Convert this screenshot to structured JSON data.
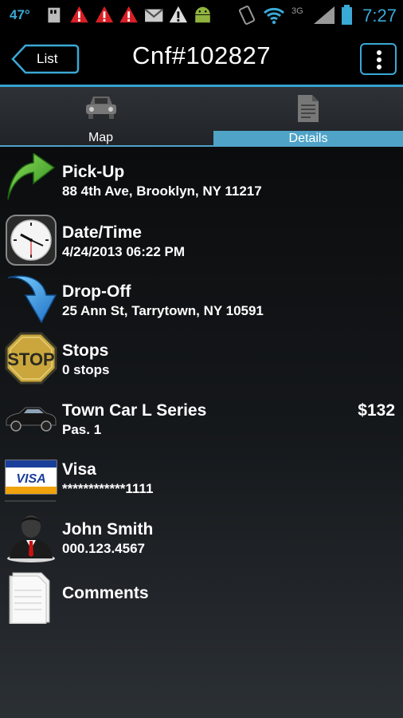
{
  "status_bar": {
    "temperature": "47°",
    "time": "7:27",
    "network": "3G",
    "icons": [
      "weather-icon",
      "sd-card-icon",
      "warning-icon",
      "warning-icon",
      "warning-icon",
      "gmail-icon",
      "alert-icon",
      "android-icon",
      "vibrate-icon",
      "wifi-icon",
      "signal-icon",
      "battery-icon"
    ]
  },
  "header": {
    "back_label": "List",
    "title": "Cnf#102827",
    "accent_color": "#35a3cf"
  },
  "tabs": [
    {
      "label": "Map",
      "icon": "car-icon",
      "selected": false
    },
    {
      "label": "Details",
      "icon": "document-icon",
      "selected": true
    }
  ],
  "details": {
    "pickup": {
      "title": "Pick-Up",
      "value": "88 4th Ave, Brooklyn, NY 11217",
      "icon": "green-arrow-up-icon"
    },
    "datetime": {
      "title": "Date/Time",
      "value": "4/24/2013 06:22 PM",
      "icon": "clock-icon"
    },
    "dropoff": {
      "title": "Drop-Off",
      "value": "25 Ann St, Tarrytown, NY 10591",
      "icon": "blue-arrow-down-icon"
    },
    "stops": {
      "title": "Stops",
      "value": "0 stops",
      "icon": "stop-sign-icon",
      "sign_text": "STOP"
    },
    "vehicle": {
      "title": "Town Car L Series",
      "value": "Pas. 1",
      "price": "$132",
      "icon": "town-car-icon"
    },
    "payment": {
      "title": "Visa",
      "value": "************1111",
      "icon": "visa-card-icon",
      "card_text": "VISA"
    },
    "passenger": {
      "title": "John Smith",
      "value": "000.123.4567",
      "icon": "person-icon"
    },
    "comments": {
      "title": "Comments",
      "icon": "notepad-icon"
    }
  }
}
